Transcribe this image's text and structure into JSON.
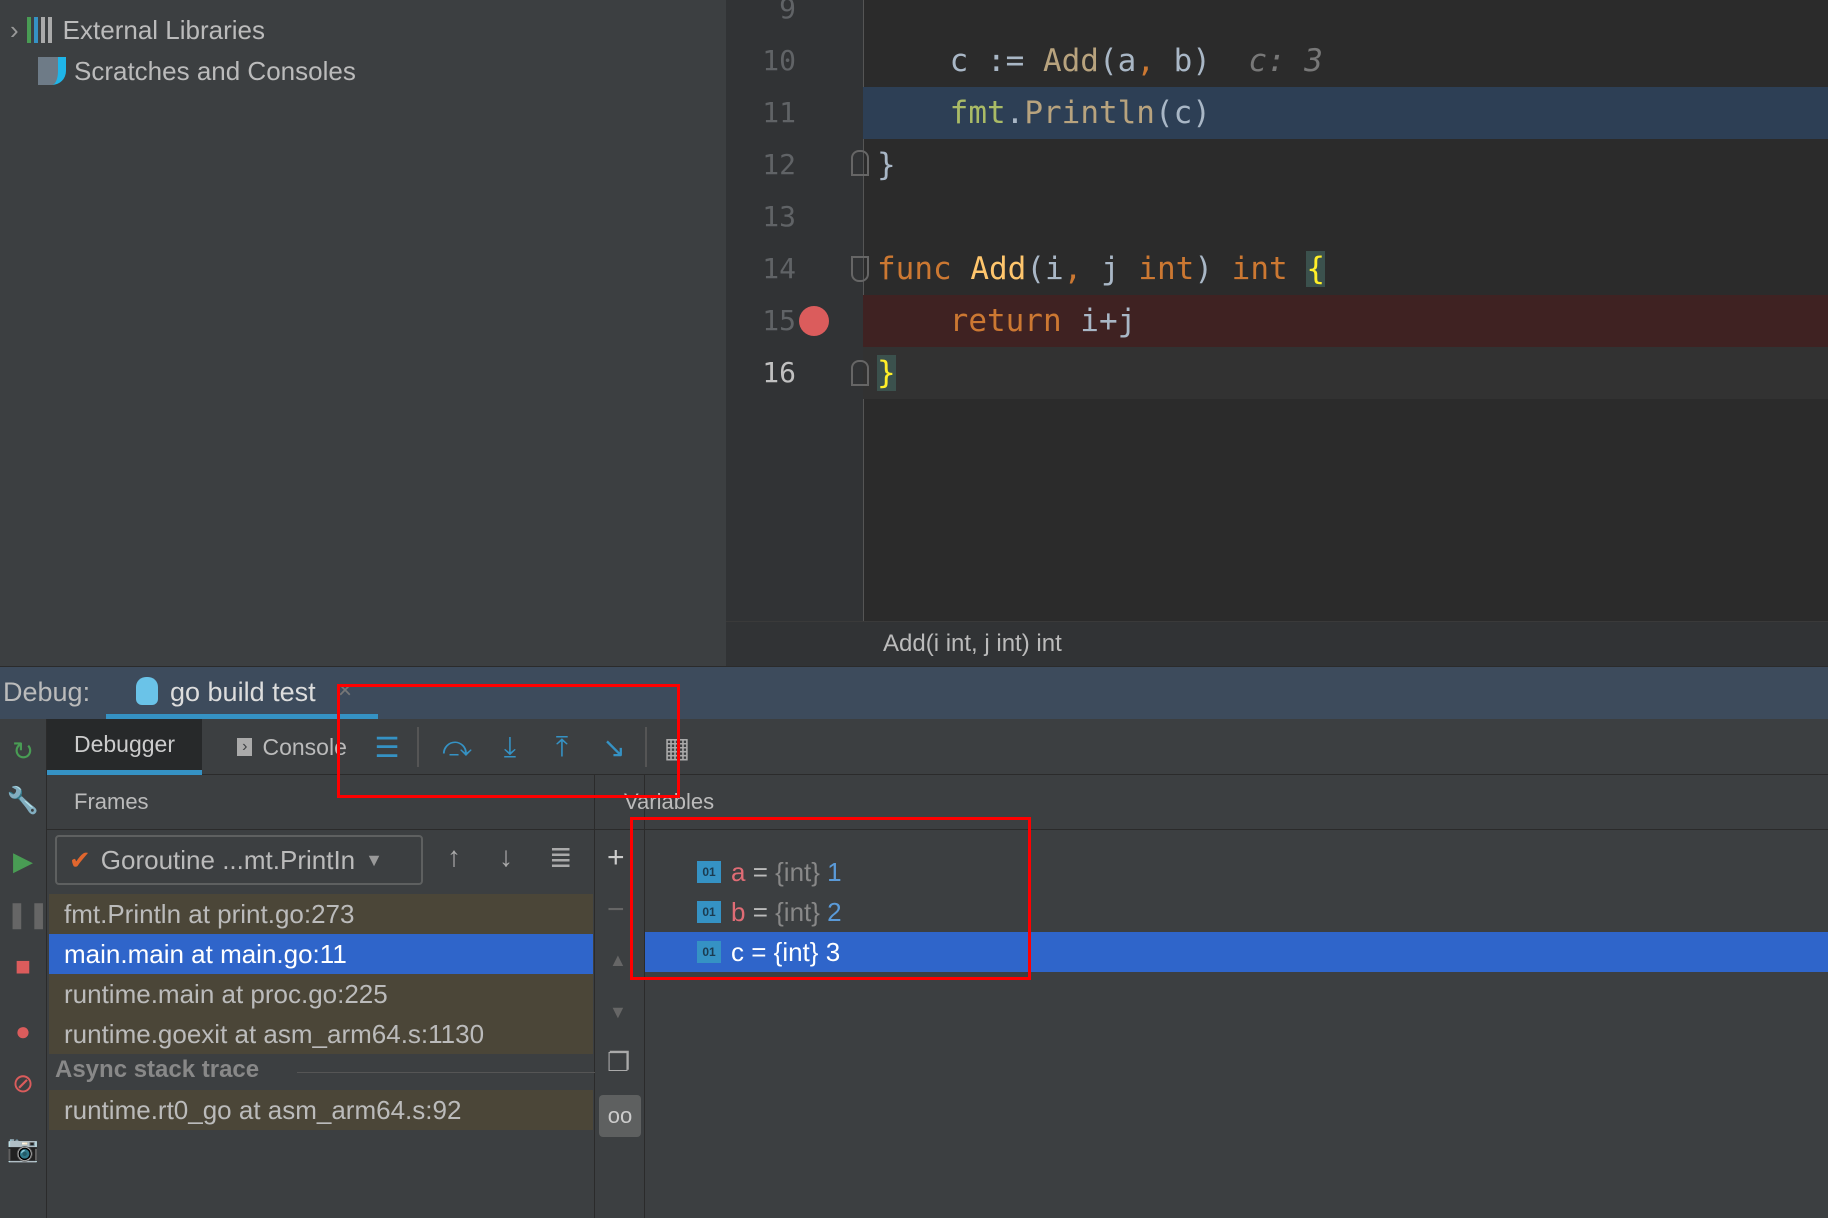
{
  "project_tree": {
    "items": [
      {
        "label": "External Libraries",
        "icon": "library-icon"
      },
      {
        "label": "Scratches and Consoles",
        "icon": "scratches-icon"
      }
    ]
  },
  "editor": {
    "lines": [
      {
        "n": "9"
      },
      {
        "n": "10",
        "hint": "c: 3"
      },
      {
        "n": "11"
      },
      {
        "n": "12"
      },
      {
        "n": "13"
      },
      {
        "n": "14"
      },
      {
        "n": "15"
      },
      {
        "n": "16"
      }
    ],
    "breadcrumb": "Add(i int, j int) int",
    "breakpoint_line": "15",
    "execution_line": "11"
  },
  "debug": {
    "label": "Debug:",
    "session_tab": "go build test",
    "tabs": [
      {
        "label": "Debugger",
        "active": true
      },
      {
        "label": "Console"
      }
    ],
    "frames_header": "Frames",
    "variables_header": "Variables",
    "goroutine": "Goroutine ...mt.PrintIn",
    "frames": [
      "fmt.Println at print.go:273",
      "main.main at main.go:11",
      "runtime.main at proc.go:225",
      "runtime.goexit at asm_arm64.s:1130"
    ],
    "async_label": "Async stack trace",
    "async_frames": [
      "runtime.rt0_go at asm_arm64.s:92"
    ],
    "variables": [
      {
        "name": "a",
        "type": "{int}",
        "value": "1"
      },
      {
        "name": "b",
        "type": "{int}",
        "value": "2"
      },
      {
        "name": "c",
        "type": "{int}",
        "value": "3",
        "selected": true
      }
    ],
    "var_icon_text": "01"
  },
  "colors": {
    "accent": "#2f65ca",
    "highlight": "#ff0000",
    "breakpoint": "#db5c5c"
  }
}
